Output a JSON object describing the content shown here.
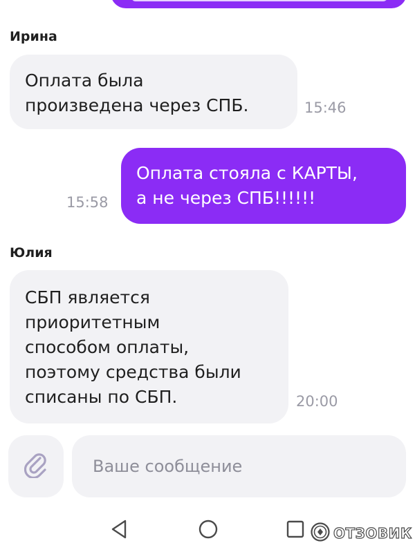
{
  "messages": [
    {
      "sender": "Ирина",
      "text_lines": [
        "Оплата была",
        "произведена через СПБ."
      ],
      "time": "15:46",
      "direction": "incoming"
    },
    {
      "sender": "",
      "text_lines": [
        "Оплата стояла с КАРТЫ,",
        "а не через СПБ!!!!!!"
      ],
      "time": "15:58",
      "direction": "outgoing"
    },
    {
      "sender": "Юлия",
      "text_lines": [
        "СБП является",
        "приоритетным",
        "способом оплаты,",
        "поэтому средства были",
        "списаны по СБП."
      ],
      "time": "20:00",
      "direction": "incoming"
    }
  ],
  "composer": {
    "attach_icon": "paperclip-icon",
    "placeholder": "Ваше сообщение",
    "value": ""
  },
  "nav": {
    "back_icon": "triangle-back-icon",
    "home_icon": "circle-home-icon",
    "recents_icon": "square-recents-icon"
  },
  "watermark": {
    "text": "ОТЗОВИК"
  },
  "colors": {
    "accent": "#8b2cf5",
    "bubble_in": "#f2f2f5",
    "time": "#9a9aa5",
    "background": "#ffffff"
  }
}
